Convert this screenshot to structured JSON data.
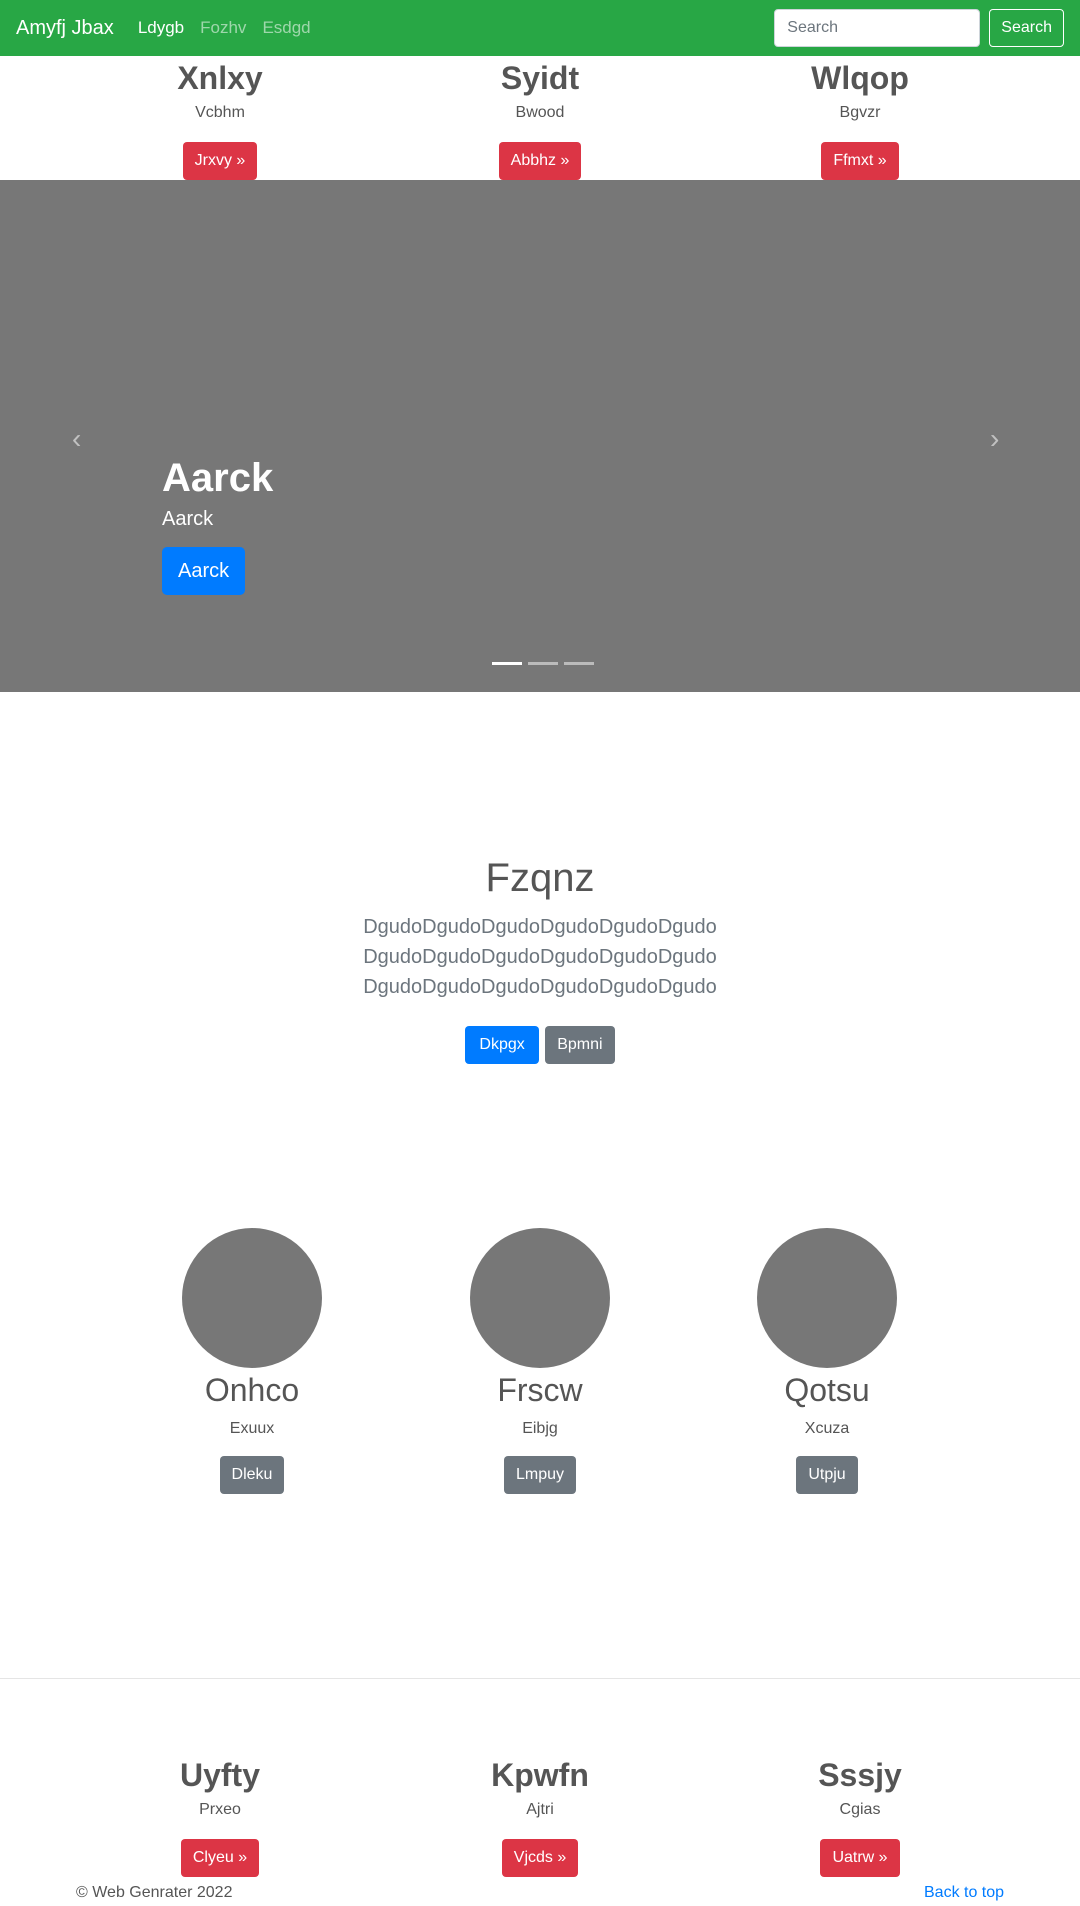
{
  "navbar": {
    "brand": "Amyfj Jbax",
    "links": [
      "Ldygb",
      "Fozhv",
      "Esdgd"
    ],
    "search_placeholder": "Search",
    "search_button": "Search"
  },
  "top_features": [
    {
      "title": "Xnlxy",
      "subtitle": "Vcbhm",
      "button": "Jrxvy »"
    },
    {
      "title": "Syidt",
      "subtitle": "Bwood",
      "button": "Abbhz »"
    },
    {
      "title": "Wlqop",
      "subtitle": "Bgvzr",
      "button": "Ffmxt »"
    }
  ],
  "carousel": {
    "prev_icon": "‹",
    "next_icon": "›",
    "title": "Aarck",
    "text": "Aarck",
    "button": "Aarck",
    "slide_count": 3,
    "active_slide": 1
  },
  "jumbotron": {
    "title": "Fzqnz",
    "text": "DgudoDgudoDgudoDgudoDgudoDgudo DgudoDgudoDgudoDgudoDgudoDgudo DgudoDgudoDgudoDgudoDgudoDgudo",
    "primary_button": "Dkpgx",
    "secondary_button": "Bpmni"
  },
  "circles": [
    {
      "title": "Onhco",
      "subtitle": "Exuux",
      "button": "Dleku"
    },
    {
      "title": "Frscw",
      "subtitle": "Eibjg",
      "button": "Lmpuy"
    },
    {
      "title": "Qotsu",
      "subtitle": "Xcuza",
      "button": "Utpju"
    }
  ],
  "bottom_features": [
    {
      "title": "Uyfty",
      "subtitle": "Prxeo",
      "button": "Clyeu »"
    },
    {
      "title": "Kpwfn",
      "subtitle": "Ajtri",
      "button": "Vjcds »"
    },
    {
      "title": "Sssjy",
      "subtitle": "Cgias",
      "button": "Uatrw »"
    }
  ],
  "footer": {
    "copyright": "© Web Genrater 2022",
    "back_to_top": "Back to top"
  },
  "colors": {
    "navbar": "#28a745",
    "primary": "#007bff",
    "danger": "#dc3545",
    "secondary": "#6c757d",
    "placeholder": "#777777"
  }
}
